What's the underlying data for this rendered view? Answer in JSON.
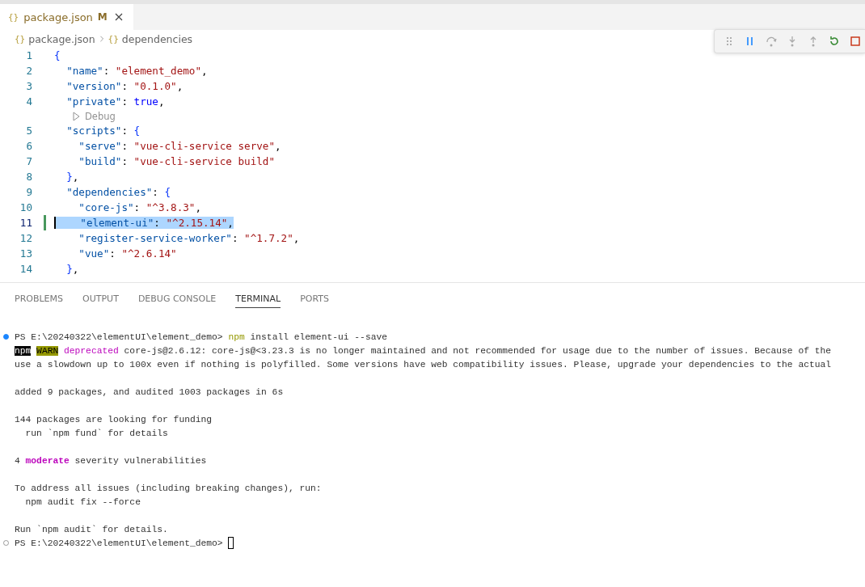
{
  "editor_tab": {
    "icon_text": "{}",
    "label": "package.json",
    "badge": "M",
    "selected": true
  },
  "breadcrumb": [
    {
      "icon_text": "{}",
      "label": "package.json"
    },
    {
      "icon_text": "{}",
      "label": "dependencies"
    }
  ],
  "code_lines": [
    {
      "kind": "code",
      "number": "1",
      "tokens": [
        {
          "kind": "open",
          "text": "{"
        }
      ]
    },
    {
      "kind": "code",
      "number": "2",
      "tokens": [
        {
          "kind": "key",
          "text": "\"name\""
        },
        {
          "kind": "plain",
          "text": ":"
        },
        {
          "kind": "string",
          "text": "\"element_demo\""
        },
        {
          "kind": "plain",
          "text": ","
        }
      ]
    },
    {
      "kind": "code",
      "number": "3",
      "tokens": [
        {
          "kind": "key",
          "text": "\"version\""
        },
        {
          "kind": "plain",
          "text": ":"
        },
        {
          "kind": "string",
          "text": "\"0.1.0\""
        },
        {
          "kind": "plain",
          "text": ","
        }
      ]
    },
    {
      "kind": "code",
      "number": "4",
      "tokens": [
        {
          "kind": "key",
          "text": "\"private\""
        },
        {
          "kind": "plain",
          "text": ":"
        },
        {
          "kind": "bool",
          "text": "true"
        },
        {
          "kind": "plain",
          "text": ","
        }
      ]
    },
    {
      "kind": "codelens",
      "label": "Debug"
    },
    {
      "kind": "code",
      "number": "5",
      "tokens": [
        {
          "kind": "key",
          "text": "\"scripts\""
        },
        {
          "kind": "plain",
          "text": ":"
        },
        {
          "kind": "open",
          "text": "{"
        }
      ]
    },
    {
      "kind": "code",
      "number": "6",
      "tokens": [
        {
          "kind": "key",
          "text": "\"serve\""
        },
        {
          "kind": "plain",
          "text": ":"
        },
        {
          "kind": "string",
          "text": "\"vue-cli-service serve\""
        },
        {
          "kind": "plain",
          "text": ","
        }
      ]
    },
    {
      "kind": "code",
      "number": "7",
      "tokens": [
        {
          "kind": "key",
          "text": "\"build\""
        },
        {
          "kind": "plain",
          "text": ":"
        },
        {
          "kind": "string",
          "text": "\"vue-cli-service build\""
        }
      ]
    },
    {
      "kind": "code",
      "number": "8",
      "tokens": [
        {
          "kind": "close",
          "text": "}"
        },
        {
          "kind": "plain",
          "text": ","
        }
      ]
    },
    {
      "kind": "code",
      "number": "9",
      "tokens": [
        {
          "kind": "key",
          "text": "\"dependencies\""
        },
        {
          "kind": "plain",
          "text": ":"
        },
        {
          "kind": "open",
          "text": "{"
        }
      ]
    },
    {
      "kind": "code",
      "number": "10",
      "tokens": [
        {
          "kind": "key",
          "text": "\"core-js\""
        },
        {
          "kind": "plain",
          "text": ":"
        },
        {
          "kind": "string",
          "text": "\"^3.8.3\""
        },
        {
          "kind": "plain",
          "text": ","
        }
      ]
    },
    {
      "kind": "code",
      "number": "11",
      "selected": true,
      "modified": true,
      "tokens": [
        {
          "kind": "key",
          "text": "\"element-ui\""
        },
        {
          "kind": "plain",
          "text": ":"
        },
        {
          "kind": "string",
          "text": "\"^2.15.14\""
        },
        {
          "kind": "plain",
          "text": ","
        }
      ]
    },
    {
      "kind": "code",
      "number": "12",
      "tokens": [
        {
          "kind": "key",
          "text": "\"register-service-worker\""
        },
        {
          "kind": "plain",
          "text": ":"
        },
        {
          "kind": "string",
          "text": "\"^1.7.2\""
        },
        {
          "kind": "plain",
          "text": ","
        }
      ]
    },
    {
      "kind": "code",
      "number": "13",
      "tokens": [
        {
          "kind": "key",
          "text": "\"vue\""
        },
        {
          "kind": "plain",
          "text": ":"
        },
        {
          "kind": "string",
          "text": "\"^2.6.14\""
        }
      ]
    },
    {
      "kind": "code",
      "number": "14",
      "tokens": [
        {
          "kind": "close",
          "text": "}"
        },
        {
          "kind": "plain",
          "text": ","
        }
      ]
    }
  ],
  "panel_tabs": [
    {
      "label": "PROBLEMS",
      "selected": false
    },
    {
      "label": "OUTPUT",
      "selected": false
    },
    {
      "label": "DEBUG CONSOLE",
      "selected": false
    },
    {
      "label": "TERMINAL",
      "selected": true
    },
    {
      "label": "PORTS",
      "selected": false
    }
  ],
  "terminal_lines": [
    {
      "succeeded": true,
      "segments": [
        {
          "kind": "plain",
          "text": "PS E:\\20240322\\elementUI\\element_demo> "
        },
        {
          "kind": "command",
          "text": "npm"
        },
        {
          "kind": "plain",
          "text": " install element-ui --save"
        }
      ]
    },
    {
      "segments": [
        {
          "kind": "npm",
          "text": "npm"
        },
        {
          "kind": "warn",
          "text": "WARN"
        },
        {
          "kind": "deprecated",
          "text": "deprecated"
        },
        {
          "kind": "plain",
          "text": " core-js@2.6.12: core-js@<3.23.3 is no longer maintained and not recommended for usage due to the number of issues. Because of the"
        }
      ]
    },
    {
      "segments": [
        {
          "kind": "plain",
          "text": "use a slowdown up to 100x even if nothing is polyfilled. Some versions have web compatibility issues. Please, upgrade your dependencies to the actual"
        }
      ]
    },
    {
      "blank_before": true,
      "segments": [
        {
          "kind": "plain",
          "text": "added 9 packages, and audited 1003 packages in 6s"
        }
      ]
    },
    {
      "blank_before": true,
      "segments": [
        {
          "kind": "plain",
          "text": "144 packages are looking for funding"
        }
      ]
    },
    {
      "segments": [
        {
          "kind": "plain",
          "text": "  run `npm fund` for details"
        }
      ]
    },
    {
      "blank_before": true,
      "segments": [
        {
          "kind": "plain",
          "text": "4 "
        },
        {
          "kind": "moderate",
          "text": "moderate"
        },
        {
          "kind": "plain",
          "text": " severity vulnerabilities"
        }
      ]
    },
    {
      "blank_before": true,
      "segments": [
        {
          "kind": "plain",
          "text": "To address all issues (including breaking changes), run:"
        }
      ]
    },
    {
      "segments": [
        {
          "kind": "plain",
          "text": "  npm audit fix --force"
        }
      ]
    },
    {
      "blank_before": true,
      "segments": [
        {
          "kind": "plain",
          "text": "Run `npm audit` for details."
        }
      ]
    },
    {
      "succeeded": false,
      "cursor": true,
      "segments": [
        {
          "kind": "plain",
          "text": "PS E:\\20240322\\elementUI\\element_demo> "
        }
      ]
    }
  ]
}
